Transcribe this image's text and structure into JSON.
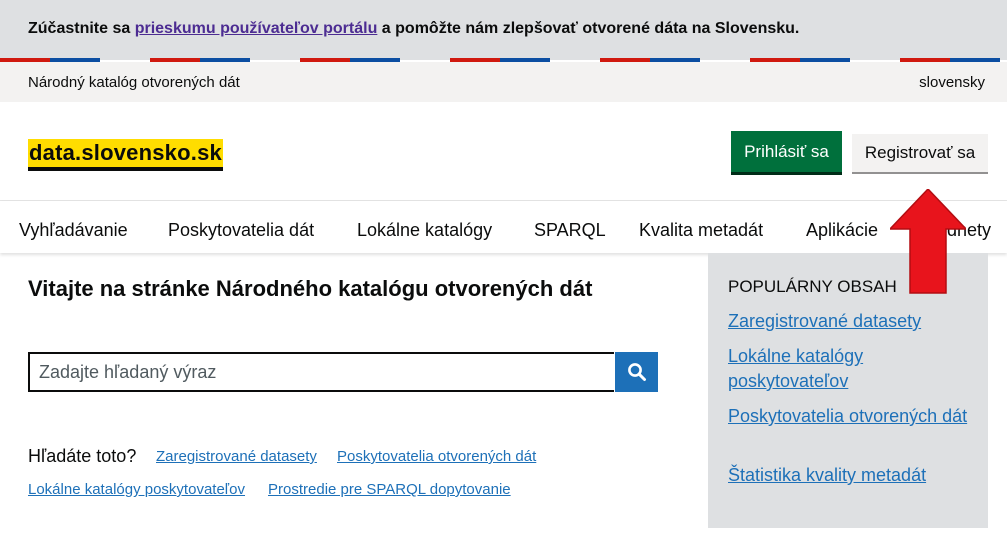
{
  "survey": {
    "prefix": "Zúčastnite sa ",
    "link": "prieskumu používateľov portálu",
    "suffix": " a pomôžte nám zlepšovať otvorené dáta na Slovensku."
  },
  "topbar": {
    "name": "Národný katalóg otvorených dát",
    "language": "slovensky"
  },
  "header": {
    "logo": "data.slovensko.sk",
    "login_label": "Prihlásiť sa",
    "register_label": "Registrovať sa"
  },
  "nav": {
    "items": [
      {
        "label": "Vyhľadávanie"
      },
      {
        "label": "Poskytovatelia dát"
      },
      {
        "label": "Lokálne katalógy"
      },
      {
        "label": "SPARQL"
      },
      {
        "label": "Kvalita metadát"
      },
      {
        "label": "Aplikácie"
      },
      {
        "label": "Podnety"
      }
    ]
  },
  "main": {
    "welcome": "Vitajte na stránke Národného katalógu otvorených dát",
    "search_placeholder": "Zadajte hľadaný výraz",
    "looking_for": "Hľadáte toto?",
    "quick_links": [
      "Zaregistrované datasety",
      "Poskytovatelia otvorených dát",
      "Lokálne katalógy poskytovateľov",
      "Prostredie pre SPARQL dopytovanie"
    ]
  },
  "sidebar": {
    "title": "POPULÁRNY OBSAH",
    "links": [
      "Zaregistrované datasety",
      "Lokálne katalógy poskytovateľov",
      "Poskytovatelia otvorených dát",
      "Štatistika kvality metadát"
    ]
  },
  "colors": {
    "login_green": "#00703c",
    "link_blue": "#1d70b8",
    "logo_yellow": "#ffdd00",
    "flag_red": "#d0190f",
    "flag_blue": "#0b4ea2",
    "annotation_red": "#e8141c"
  },
  "icons": {
    "search": "search-icon",
    "annotation": "red-arrow-icon"
  }
}
